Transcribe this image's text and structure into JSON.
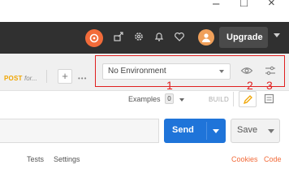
{
  "window": {
    "minimize_icon": "minimize-icon",
    "maximize_icon": "maximize-icon",
    "close_icon": "close-icon"
  },
  "header": {
    "icons": [
      "sync-icon",
      "satellite-icon",
      "gear-icon",
      "bell-icon",
      "heart-icon",
      "avatar-icon"
    ],
    "upgrade_label": "Upgrade",
    "accent_color": "#f26b3a"
  },
  "tabs": {
    "active_method": "POST",
    "active_name": "for...",
    "add_label": "+",
    "more_label": "•••"
  },
  "environment": {
    "selected": "No Environment",
    "annotations": [
      "1",
      "2",
      "3"
    ]
  },
  "examples": {
    "label": "Examples",
    "count": "0",
    "build_label": "BUILD"
  },
  "request": {
    "send_label": "Send",
    "save_label": "Save",
    "send_color": "#1f74d9"
  },
  "bottom_tabs": {
    "tests_label": "Tests",
    "settings_label": "Settings",
    "cookies_label": "Cookies",
    "code_label": "Code"
  }
}
